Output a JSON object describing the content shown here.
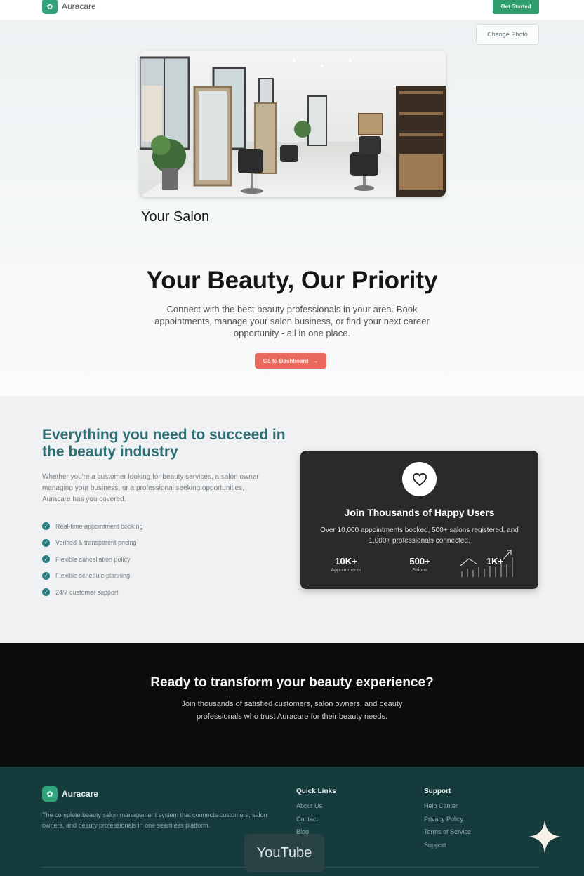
{
  "header": {
    "brand": "Auracare",
    "logo_icon": "leaf-icon",
    "get_started": "Get Started"
  },
  "hero": {
    "change_photo": "Change Photo",
    "salon_name": "Your Salon",
    "title": "Your Beauty, Our Priority",
    "subtitle": "Connect with the best beauty professionals in your area. Book appointments, manage your salon business, or find your next career opportunity - all in one place.",
    "dashboard_button": "Go to Dashboard",
    "dashboard_arrow": "→"
  },
  "features": {
    "title": "Everything you need to succeed in the beauty industry",
    "description": "Whether you're a customer looking for beauty services, a salon owner managing your business, or a professional seeking opportunities, Auracare has you covered.",
    "items": [
      {
        "label": "Real-time appointment booking"
      },
      {
        "label": "Verified & transparent pricing"
      },
      {
        "label": "Flexible cancellation policy"
      },
      {
        "label": "Flexible schedule planning"
      },
      {
        "label": "24/7 customer support"
      }
    ],
    "card": {
      "icon": "heart-icon",
      "title": "Join Thousands of Happy Users",
      "subtitle": "Over 10,000 appointments booked, 500+ salons registered, and 1,000+ professionals connected.",
      "stats": [
        {
          "value": "10K+",
          "label": "Appointments"
        },
        {
          "value": "500+",
          "label": "Salons"
        },
        {
          "value": "1K+",
          "label": ""
        }
      ]
    }
  },
  "cta": {
    "title": "Ready to transform your beauty experience?",
    "subtitle": "Join thousands of satisfied customers, salon owners, and beauty professionals who trust Auracare for their beauty needs."
  },
  "footer": {
    "brand": "Auracare",
    "description": "The complete beauty salon management system that connects customers, salon owners, and beauty professionals in one seamless platform.",
    "quick_links_title": "Quick Links",
    "quick_links": [
      "About Us",
      "Contact",
      "Blog"
    ],
    "support_title": "Support",
    "support_links": [
      "Help Center",
      "Privacy Policy",
      "Terms of Service",
      "Support"
    ]
  },
  "overlay": {
    "youtube": "YouTube",
    "sparkle_icon": "sparkle-icon"
  },
  "colors": {
    "brand_green": "#2f9d6e",
    "accent_coral": "#e96a5d",
    "teal_heading": "#2d6f74",
    "footer_bg": "#163b3d"
  }
}
